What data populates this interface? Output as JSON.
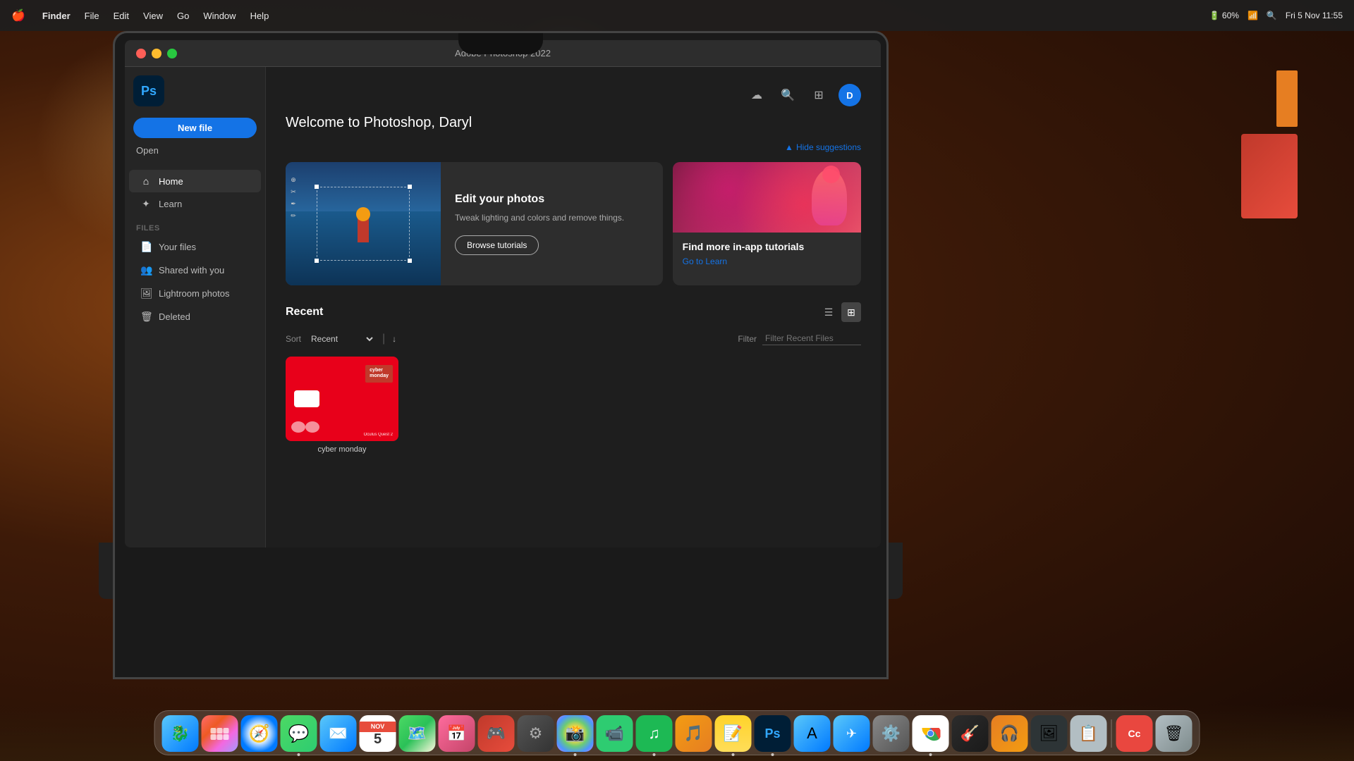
{
  "menubar": {
    "apple": "🍎",
    "items": [
      "Finder",
      "File",
      "Edit",
      "View",
      "Go",
      "Window",
      "Help"
    ],
    "active_item": "Finder",
    "right": {
      "datetime": "Fri 5 Nov  11:55",
      "wifi": "wifi",
      "battery": "60%"
    }
  },
  "window": {
    "title": "Adobe Photoshop 2022",
    "traffic_lights": {
      "close": "close",
      "minimize": "minimize",
      "maximize": "maximize"
    }
  },
  "app": {
    "logo": "Ps",
    "toolbar_icons": [
      "cloud",
      "search",
      "plugins",
      "avatar"
    ],
    "avatar_initials": "D"
  },
  "sidebar": {
    "new_file_label": "New file",
    "open_label": "Open",
    "nav_items": [
      {
        "icon": "⌂",
        "label": "Home",
        "active": true
      },
      {
        "icon": "✦",
        "label": "Learn",
        "active": false
      }
    ],
    "files_section": "FILES",
    "file_items": [
      {
        "icon": "📄",
        "label": "Your files"
      },
      {
        "icon": "👥",
        "label": "Shared with you"
      },
      {
        "icon": "🖼",
        "label": "Lightroom photos"
      },
      {
        "icon": "🗑",
        "label": "Deleted"
      }
    ]
  },
  "main": {
    "welcome_title": "Welcome to Photoshop, Daryl",
    "hide_suggestions": "Hide suggestions",
    "cards": {
      "edit_photos": {
        "title": "Edit your photos",
        "description": "Tweak lighting and colors and remove things.",
        "button": "Browse tutorials"
      },
      "tutorials": {
        "title": "Find more in-app tutorials",
        "link": "Go to Learn"
      }
    },
    "recent": {
      "title": "Recent",
      "sort_label": "Sort",
      "sort_value": "Recent",
      "filter_placeholder": "Filter Recent Files",
      "filter_label": "Filter",
      "view_list": "list",
      "view_grid": "grid"
    },
    "files": [
      {
        "name": "cyber_monday_oculus.psd",
        "display_name": "cyber monday",
        "sub_text": "Oculus Quest 2",
        "type": "cyber_monday"
      }
    ]
  },
  "dock": {
    "items": [
      {
        "name": "Finder",
        "icon": "🔵",
        "class": "dock-finder",
        "has_dot": false
      },
      {
        "name": "Launchpad",
        "icon": "🚀",
        "class": "dock-launchpad",
        "has_dot": false
      },
      {
        "name": "Safari",
        "icon": "🧭",
        "class": "dock-safari",
        "has_dot": false
      },
      {
        "name": "Messages",
        "icon": "💬",
        "class": "dock-messages",
        "has_dot": true
      },
      {
        "name": "Mail",
        "icon": "✉",
        "class": "dock-mail",
        "has_dot": false
      },
      {
        "name": "Calendar",
        "icon": "NOV 5",
        "class": "dock-calendar",
        "has_dot": false,
        "special": "calendar"
      },
      {
        "name": "Maps",
        "icon": "🗺",
        "class": "dock-maps",
        "has_dot": false
      },
      {
        "name": "Fantastical",
        "icon": "📅",
        "class": "dock-fantastical",
        "has_dot": false
      },
      {
        "name": "Backspace",
        "icon": "🎮",
        "class": "dock-bs",
        "has_dot": false
      },
      {
        "name": "Compressor",
        "icon": "⚙",
        "class": "dock-compressor",
        "has_dot": false
      },
      {
        "name": "Photos",
        "icon": "🌸",
        "class": "dock-photos",
        "has_dot": true
      },
      {
        "name": "FaceTime",
        "icon": "📹",
        "class": "dock-facetime",
        "has_dot": false
      },
      {
        "name": "Spotify",
        "icon": "♫",
        "class": "dock-spotify",
        "has_dot": true
      },
      {
        "name": "Capo",
        "icon": "🎵",
        "class": "dock-capo",
        "has_dot": false
      },
      {
        "name": "Notes",
        "icon": "📝",
        "class": "dock-notes",
        "has_dot": true
      },
      {
        "name": "Photoshop",
        "icon": "Ps",
        "class": "dock-photoshop",
        "has_dot": true,
        "ps": true
      },
      {
        "name": "App Store",
        "icon": "A",
        "class": "dock-appstore",
        "has_dot": false
      },
      {
        "name": "TestFlight",
        "icon": "✈",
        "class": "dock-testflight",
        "has_dot": false
      },
      {
        "name": "System Prefs",
        "icon": "⚙",
        "class": "dock-systemprefs",
        "has_dot": false
      },
      {
        "name": "Chrome",
        "icon": "⬤",
        "class": "dock-chrome",
        "has_dot": true
      },
      {
        "name": "GarageBand",
        "icon": "🎸",
        "class": "dock-garageband",
        "has_dot": false
      },
      {
        "name": "Headphones",
        "icon": "🎧",
        "class": "dock-headphones",
        "has_dot": false
      },
      {
        "name": "Image Tools",
        "icon": "🖼",
        "class": "dock-imagetools",
        "has_dot": false
      },
      {
        "name": "Archive",
        "icon": "🗜",
        "class": "dock-archive",
        "has_dot": false
      },
      {
        "name": "Adobe CC",
        "icon": "Cc",
        "class": "dock-adobe",
        "has_dot": false
      },
      {
        "name": "Trash",
        "icon": "🗑",
        "class": "dock-trash",
        "has_dot": false
      }
    ]
  }
}
